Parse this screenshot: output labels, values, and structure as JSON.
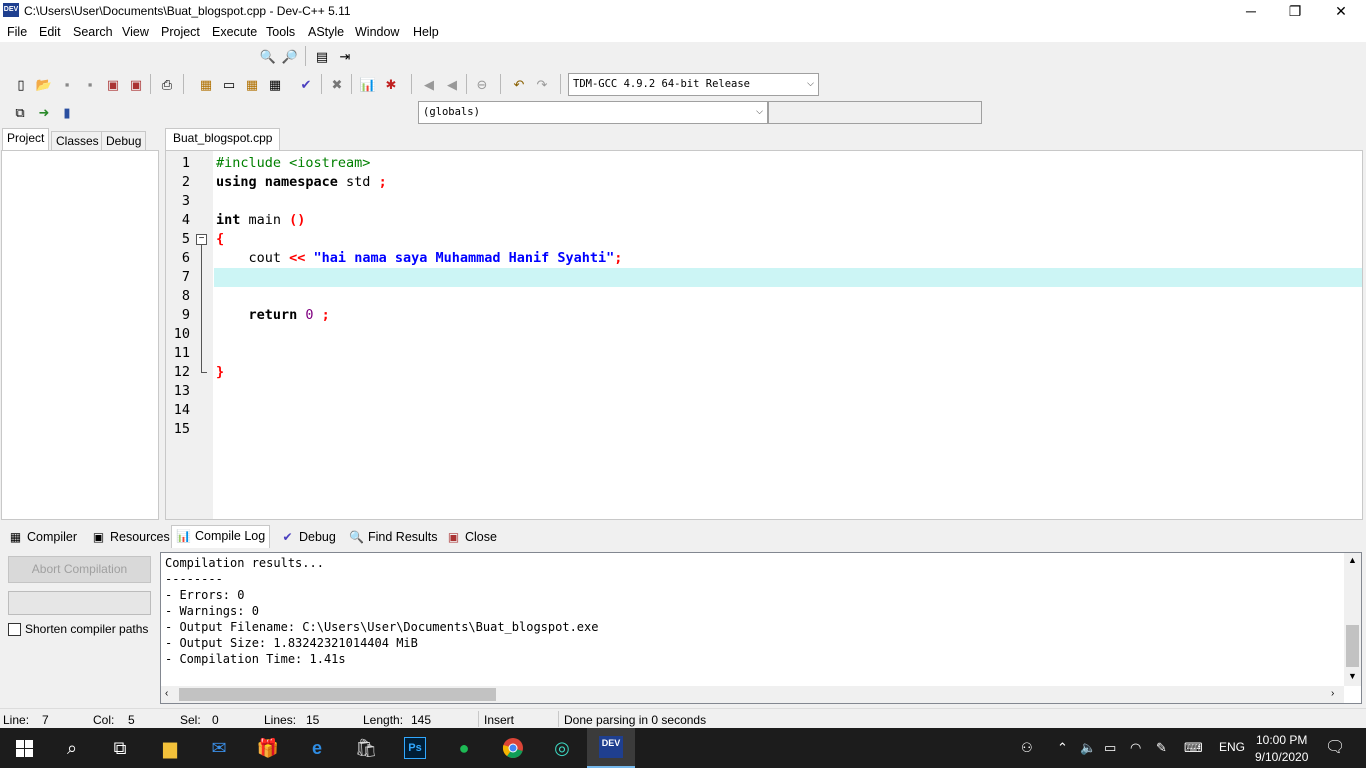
{
  "window": {
    "title": "C:\\Users\\User\\Documents\\Buat_blogspot.cpp - Dev-C++ 5.11",
    "app_icon_text": "DEV",
    "minimize": "─",
    "restore": "❐",
    "close": "✕"
  },
  "menu": [
    "File",
    "Edit",
    "Search",
    "View",
    "Project",
    "Execute",
    "Tools",
    "AStyle",
    "Window",
    "Help"
  ],
  "toolbar": {
    "compiler_select": "TDM-GCC 4.9.2 64-bit Release",
    "scope_select": "(globals)",
    "member_select": ""
  },
  "left_tabs": [
    "Project",
    "Classes",
    "Debug"
  ],
  "editor_tab": "Buat_blogspot.cpp",
  "line_numbers": [
    "1",
    "2",
    "3",
    "4",
    "5",
    "6",
    "7",
    "8",
    "9",
    "10",
    "11",
    "12",
    "13",
    "14",
    "15"
  ],
  "code": {
    "l1": "#include <iostream>",
    "l2_kw": "using namespace",
    "l2_id": " std ",
    "l2_semi": ";",
    "l4_kw": "int",
    "l4_id": " main ",
    "l4_par": "()",
    "l5": "{",
    "l6_id": "    cout ",
    "l6_op": "<<",
    "l6_str": " \"hai nama saya Muhammad Hanif Syahti\"",
    "l6_semi": ";",
    "l9_kw": "    return",
    "l9_num": " 0",
    "l9_semi": " ;",
    "l12": "}"
  },
  "bottom_tabs": [
    "Compiler",
    "Resources",
    "Compile Log",
    "Debug",
    "Find Results",
    "Close"
  ],
  "compile_panel": {
    "abort_label": "Abort Compilation",
    "shorten_label": "Shorten compiler paths",
    "shorten_checked": false
  },
  "compile_log": [
    "Compilation results...",
    "--------",
    "- Errors: 0",
    "- Warnings: 0",
    "- Output Filename: C:\\Users\\User\\Documents\\Buat_blogspot.exe",
    "- Output Size: 1.83242321014404 MiB",
    "- Compilation Time: 1.41s"
  ],
  "status": {
    "line_label": "Line:",
    "line_value": "7",
    "col_label": "Col:",
    "col_value": "5",
    "sel_label": "Sel:",
    "sel_value": "0",
    "lines_label": "Lines:",
    "lines_value": "15",
    "length_label": "Length:",
    "length_value": "145",
    "mode": "Insert",
    "message": "Done parsing in 0 seconds"
  },
  "taskbar": {
    "language": "ENG",
    "time": "10:00 PM",
    "date": "9/10/2020",
    "ps_label": "Ps",
    "dev_label": "DEV"
  },
  "colors": {
    "current_line": "#ccf5f5",
    "preprocessor": "#008000",
    "string": "#0000ff",
    "symbol": "#ff0000",
    "number": "#800080",
    "taskbar": "#1c1c1c"
  }
}
